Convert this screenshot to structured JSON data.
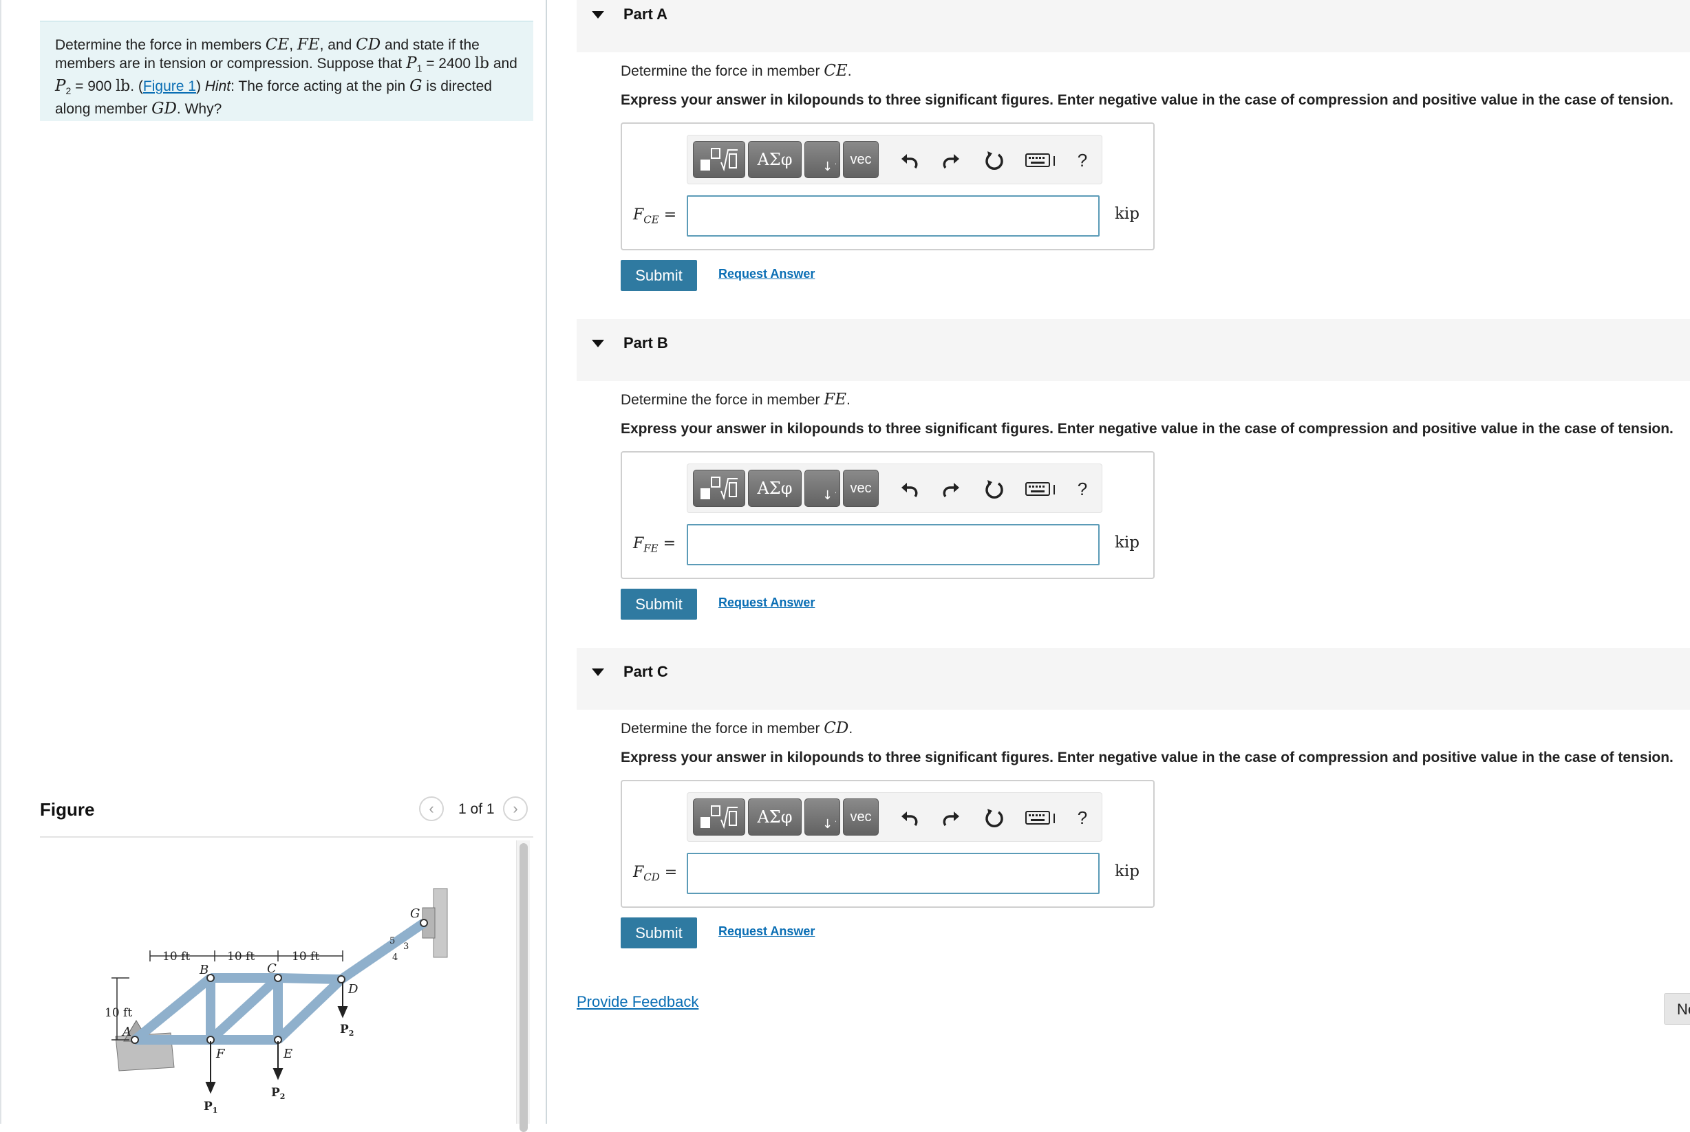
{
  "problem": {
    "t1": "Determine the force in members ",
    "m_ce": "CE",
    "comma1": ", ",
    "m_fe": "FE",
    "t2": ", and ",
    "m_cd": "CD",
    "t3": " and state if the members are in tension or compression. Suppose that ",
    "p1_sym": "P",
    "p1_sub": "1",
    "p1_val": " = 2400 ",
    "p1_unit": "lb",
    "t4": " and ",
    "p2_sym": "P",
    "p2_sub": "2",
    "p2_val": " = 900 ",
    "p2_unit": "lb",
    "t5": ". (",
    "figure_link": "Figure 1",
    "t6": ") ",
    "hint_label": "Hint",
    "t7": ": The force acting at the pin ",
    "m_g": "G",
    "t8": " is directed along member ",
    "m_gd": "GD",
    "t9": ". Why?"
  },
  "figure": {
    "title": "Figure",
    "counter": "1 of 1",
    "prev_icon": "chevron-left-icon",
    "next_icon": "chevron-right-icon",
    "dims": [
      "10 ft",
      "10 ft",
      "10 ft"
    ],
    "height_dim": "10 ft",
    "labels": {
      "A": "A",
      "B": "B",
      "C": "C",
      "D": "D",
      "E": "E",
      "F": "F",
      "G": "G"
    },
    "slope": {
      "rise": "3",
      "run": "4",
      "hyp": "5"
    },
    "loads": {
      "p1": "P",
      "p1_sub": "1",
      "p2": "P",
      "p2_sub": "2"
    },
    "colors": {
      "member": "#8fb0cc",
      "member_edge": "#4a6a88",
      "support": "#c7c7c7"
    }
  },
  "parts": [
    {
      "title": "Part A",
      "prompt_prefix": "Determine the force in member ",
      "prompt_member": "CE",
      "prompt_suffix": ".",
      "instruction": "Express your answer in kilopounds to three significant figures. Enter negative value in the case of compression and positive value in the case of tension.",
      "var_main": "F",
      "var_sub": "CE",
      "equals": " =",
      "answer_value": "",
      "unit": "kip",
      "submit": "Submit",
      "request": "Request Answer"
    },
    {
      "title": "Part B",
      "prompt_prefix": "Determine the force in member ",
      "prompt_member": "FE",
      "prompt_suffix": ".",
      "instruction": "Express your answer in kilopounds to three significant figures. Enter negative value in the case of compression and positive value in the case of tension.",
      "var_main": "F",
      "var_sub": "FE",
      "equals": " =",
      "answer_value": "",
      "unit": "kip",
      "submit": "Submit",
      "request": "Request Answer"
    },
    {
      "title": "Part C",
      "prompt_prefix": "Determine the force in member ",
      "prompt_member": "CD",
      "prompt_suffix": ".",
      "instruction": "Express your answer in kilopounds to three significant figures. Enter negative value in the case of compression and positive value in the case of tension.",
      "var_main": "F",
      "var_sub": "CD",
      "equals": " =",
      "answer_value": "",
      "unit": "kip",
      "submit": "Submit",
      "request": "Request Answer"
    }
  ],
  "toolbar": {
    "greek_label": "ΑΣφ",
    "vec_label": "vec",
    "help_label": "?",
    "icons": [
      "templates-icon",
      "greek-symbols-icon",
      "subscript-superscript-icon",
      "vector-icon",
      "undo-icon",
      "redo-icon",
      "reset-icon",
      "keyboard-icon",
      "help-icon"
    ]
  },
  "footer": {
    "feedback": "Provide Feedback",
    "next_partial": "Ne"
  }
}
